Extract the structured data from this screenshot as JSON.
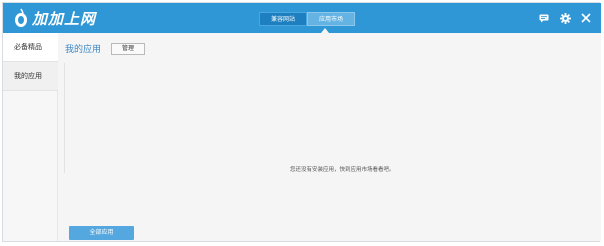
{
  "app": {
    "name": "加加上网"
  },
  "tabs": [
    {
      "label": "兼容网站",
      "active": false
    },
    {
      "label": "应用市场",
      "active": true
    }
  ],
  "toolbar": {
    "icons": [
      "chat-icon",
      "gear-icon",
      "close-icon"
    ]
  },
  "sidebar": {
    "items": [
      {
        "label": "必备精品",
        "active": true
      },
      {
        "label": "我的应用",
        "active": false
      }
    ]
  },
  "main": {
    "title": "我的应用",
    "manage_label": "管理",
    "empty_message": "您还没有安装应用，快到应用市场看看吧。",
    "all_apps_label": "全部应用"
  },
  "colors": {
    "titlebar": "#2f97d5",
    "accent": "#3b86c6",
    "button": "#55a8df"
  }
}
